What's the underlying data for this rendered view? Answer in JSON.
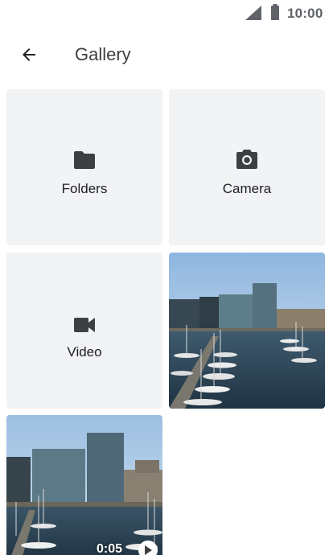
{
  "status_bar": {
    "time": "10:00",
    "icons": [
      "signal-icon",
      "battery-icon"
    ]
  },
  "app_bar": {
    "title": "Gallery",
    "back_icon": "arrow-back-icon"
  },
  "tiles": [
    {
      "label": "Folders",
      "icon": "folder-icon"
    },
    {
      "label": "Camera",
      "icon": "camera-icon"
    },
    {
      "label": "Video",
      "icon": "videocam-icon"
    }
  ],
  "media": [
    {
      "kind": "photo",
      "subject": "marina"
    },
    {
      "kind": "video",
      "duration": "0:05",
      "subject": "marina"
    }
  ],
  "colors": {
    "tile_bg": "#f1f3f4",
    "icon": "#3c4043",
    "text": "#202124"
  }
}
